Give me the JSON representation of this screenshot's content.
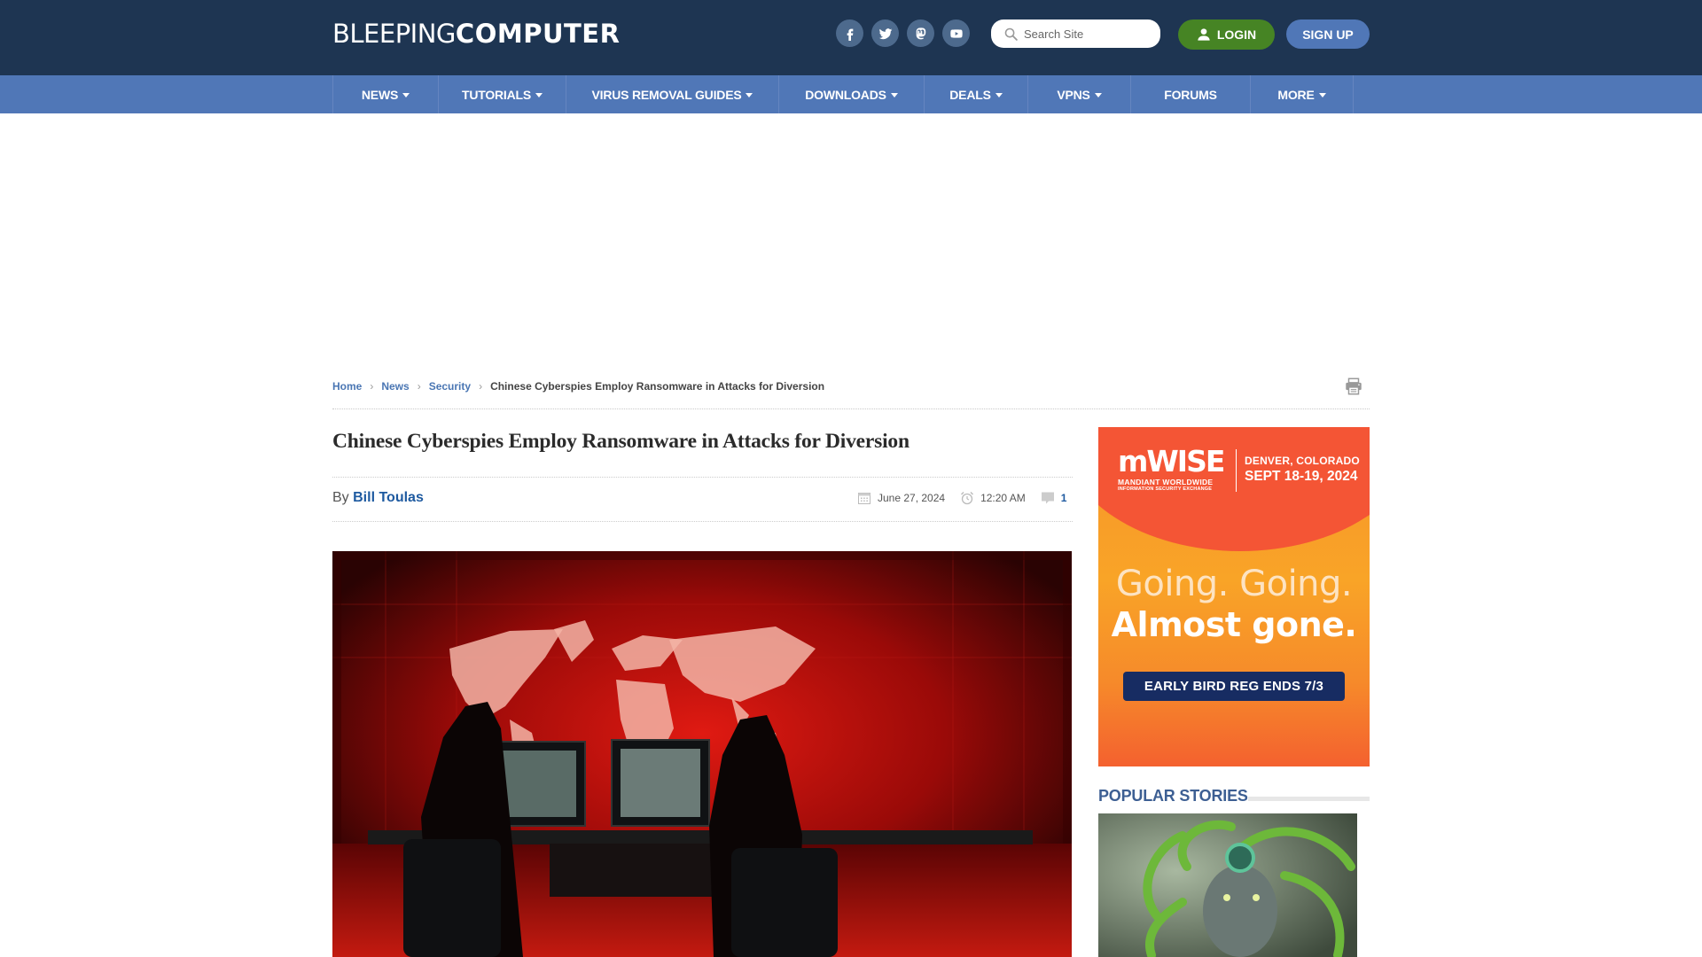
{
  "header": {
    "logo_light": "BLEEPING",
    "logo_bold": "COMPUTER",
    "socials": [
      {
        "name": "facebook",
        "icon": "facebook-icon"
      },
      {
        "name": "twitter",
        "icon": "twitter-icon"
      },
      {
        "name": "mastodon",
        "icon": "mastodon-icon"
      },
      {
        "name": "youtube",
        "icon": "youtube-icon"
      }
    ],
    "search_placeholder": "Search Site",
    "login_label": "LOGIN",
    "signup_label": "SIGN UP",
    "colors": {
      "header_bg": "#1e3552",
      "nav_bg": "#5077b7",
      "login_bg": "#468424",
      "signup_bg": "#5077b7"
    }
  },
  "nav": {
    "items": [
      {
        "label": "NEWS",
        "dropdown": true
      },
      {
        "label": "TUTORIALS",
        "dropdown": true
      },
      {
        "label": "VIRUS REMOVAL GUIDES",
        "dropdown": true
      },
      {
        "label": "DOWNLOADS",
        "dropdown": true
      },
      {
        "label": "DEALS",
        "dropdown": true
      },
      {
        "label": "VPNS",
        "dropdown": true
      },
      {
        "label": "FORUMS",
        "dropdown": false
      },
      {
        "label": "MORE",
        "dropdown": true
      }
    ]
  },
  "breadcrumb": {
    "items": [
      "Home",
      "News",
      "Security"
    ],
    "current": "Chinese Cyberspies Employ Ransomware in Attacks for Diversion"
  },
  "article": {
    "title": "Chinese Cyberspies Employ Ransomware in Attacks for Diversion",
    "by_label": "By",
    "author": "Bill Toulas",
    "date": "June 27, 2024",
    "time": "12:20 AM",
    "comment_count": "1",
    "hero_alt": "Hooded hackers at computers in front of red world map"
  },
  "sidebar": {
    "ad": {
      "brand": "mWISE",
      "brand_sub1": "MANDIANT WORLDWIDE",
      "brand_sub2": "INFORMATION SECURITY EXCHANGE",
      "location": "DENVER, COLORADO",
      "dates": "SEPT 18-19, 2024",
      "headline1": "Going. Going.",
      "headline2": "Almost gone.",
      "cta": "EARLY BIRD REG ENDS 7/3"
    },
    "popular_title": "POPULAR STORIES"
  }
}
